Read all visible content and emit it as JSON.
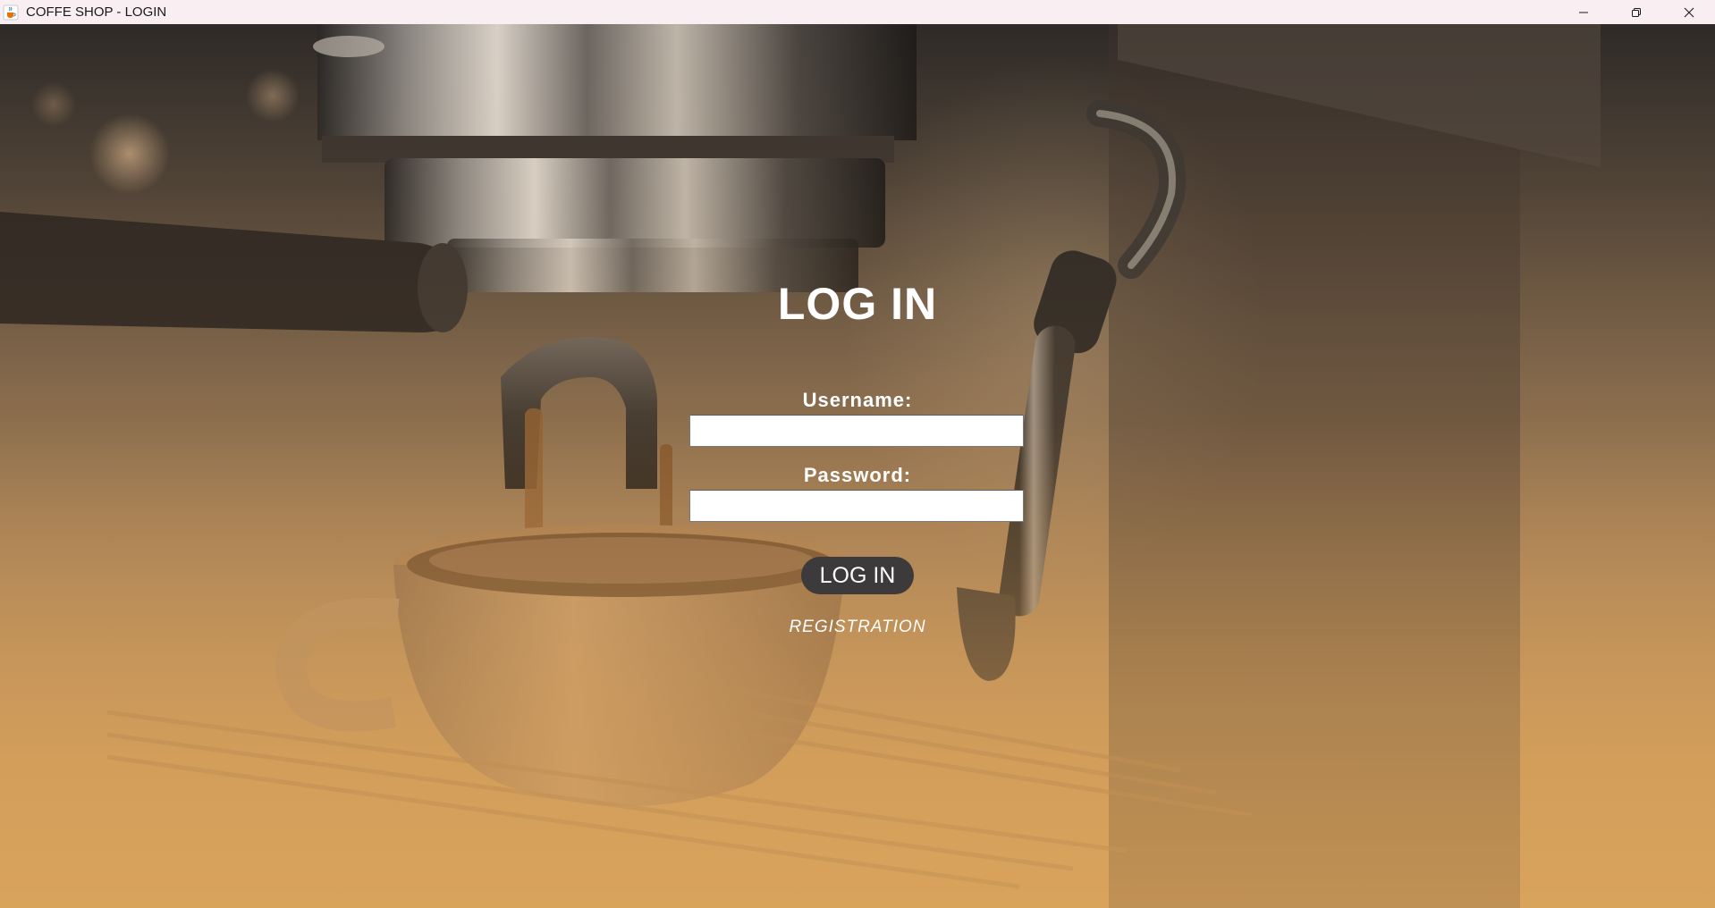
{
  "window": {
    "title": "COFFE SHOP - LOGIN",
    "app_icon": "java-cup-icon",
    "controls": {
      "minimize_icon": "minimize-icon",
      "restore_icon": "restore-icon",
      "close_icon": "close-icon"
    }
  },
  "login": {
    "title": "LOG IN",
    "username_label": "Username:",
    "username_value": "",
    "password_label": "Password:",
    "password_value": "",
    "login_button_label": "LOG IN",
    "registration_link": "REGISTRATION"
  },
  "colors": {
    "titlebar_bg": "#f9eff2",
    "button_bg": "#3c3a3a",
    "text": "#ffffff",
    "background_tone": "#d9a25c"
  }
}
